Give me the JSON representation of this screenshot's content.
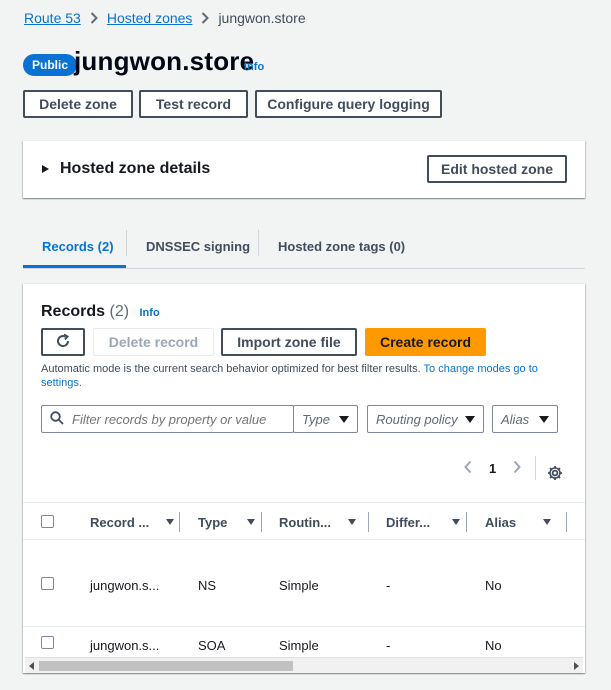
{
  "breadcrumb": {
    "items": [
      "Route 53",
      "Hosted zones"
    ],
    "current": "jungwon.store"
  },
  "header": {
    "badge": "Public",
    "title": "jungwon.store",
    "info": "Info"
  },
  "actions": {
    "delete_zone": "Delete zone",
    "test_record": "Test record",
    "configure_logging": "Configure query logging"
  },
  "details": {
    "title": "Hosted zone details",
    "edit_button": "Edit hosted zone"
  },
  "tabs": [
    "Records (2)",
    "DNSSEC signing",
    "Hosted zone tags (0)"
  ],
  "records": {
    "title": "Records",
    "count": "(2)",
    "info": "Info",
    "delete_button": "Delete record",
    "import_button": "Import zone file",
    "create_button": "Create record",
    "hint_text": "Automatic mode is the current search behavior optimized for best filter results. ",
    "hint_link": "To change modes go to settings.",
    "filter_placeholder": "Filter records by property or value",
    "selects": {
      "type": "Type",
      "routing": "Routing policy",
      "alias": "Alias"
    },
    "page": "1",
    "columns": [
      "Record ...",
      "Type",
      "Routin...",
      "Differ...",
      "Alias"
    ],
    "rows": [
      {
        "name": "jungwon.s...",
        "type": "NS",
        "routing": "Simple",
        "differ": "-",
        "alias": "No"
      },
      {
        "name": "jungwon.s...",
        "type": "SOA",
        "routing": "Simple",
        "differ": "-",
        "alias": "No"
      }
    ]
  },
  "colors": {
    "link": "#0972d3",
    "primary": "#ff9900",
    "background": "#f2f3f3"
  }
}
